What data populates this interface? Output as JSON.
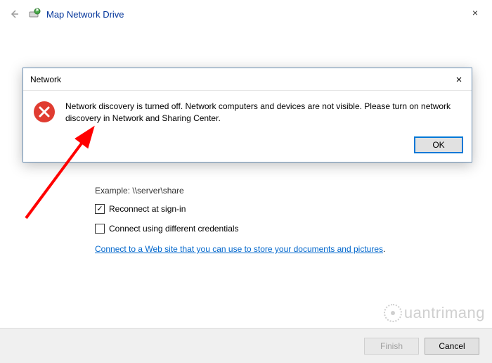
{
  "window": {
    "title": "Map Network Drive",
    "close_label": "×"
  },
  "content": {
    "example_label": "Example: \\\\server\\share",
    "checkbox_reconnect": "Reconnect at sign-in",
    "checkbox_reconnect_checked": true,
    "checkbox_credentials": "Connect using different credentials",
    "checkbox_credentials_checked": false,
    "link_text": "Connect to a Web site that you can use to store your documents and pictures",
    "link_period": "."
  },
  "footer": {
    "finish_label": "Finish",
    "cancel_label": "Cancel"
  },
  "modal": {
    "title": "Network",
    "close_label": "×",
    "message": "Network discovery is turned off. Network computers and devices are not visible. Please turn on network discovery in Network and Sharing Center.",
    "ok_label": "OK"
  },
  "watermark": {
    "text": "uantrimang"
  }
}
